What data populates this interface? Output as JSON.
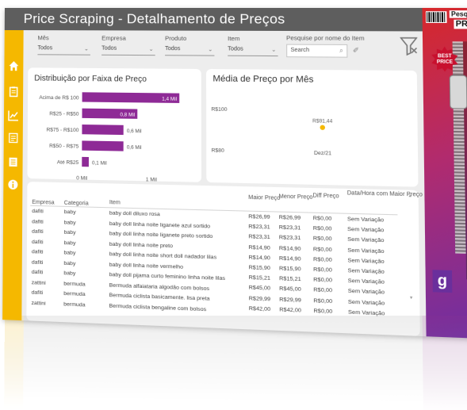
{
  "header": {
    "title": "Price Scraping - Detalhamento de Preços"
  },
  "filters": [
    {
      "label": "Mês",
      "value": "Todos"
    },
    {
      "label": "Empresa",
      "value": "Todos"
    },
    {
      "label": "Produto",
      "value": "Todos"
    },
    {
      "label": "Item",
      "value": "Todos"
    }
  ],
  "search": {
    "label": "Pesquise por nome do Item",
    "placeholder": "Search"
  },
  "sidebar_icons": [
    "home-icon",
    "clipboard-icon",
    "chart-icon",
    "document-icon",
    "list-icon",
    "info-icon"
  ],
  "banner": {
    "line1": "Pesquisa de",
    "line2": "PREÇOS",
    "badge1": "BEST",
    "badge2": "PRICE",
    "logo": "g"
  },
  "bar_chart": {
    "title": "Distribuição por Faixa de Preço",
    "categories": [
      "Acima de R$ 100",
      "R$25 - R$50",
      "R$75 - R$100",
      "R$50 - R$75",
      "Até R$25"
    ],
    "values_label": [
      "1,4 Mil",
      "0,8 Mil",
      "0,6 Mil",
      "0,6 Mil",
      "0,1 Mil"
    ],
    "axis_ticks": [
      "0 Mil",
      "1 Mil"
    ]
  },
  "line_chart": {
    "title": "Média de Preço por Mês",
    "y_ticks": [
      "R$100",
      "R$80"
    ],
    "point_label": "R$91,44",
    "x_tick": "Dez/21"
  },
  "chart_data": [
    {
      "type": "bar",
      "title": "Distribuição por Faixa de Preço",
      "categories": [
        "Acima de R$ 100",
        "R$25 - R$50",
        "R$75 - R$100",
        "R$50 - R$75",
        "Até R$25"
      ],
      "values": [
        1400,
        800,
        600,
        600,
        100
      ],
      "xlim": [
        0,
        1500
      ],
      "color": "#8e2a96"
    },
    {
      "type": "scatter",
      "title": "Média de Preço por Mês",
      "x": [
        "Dez/21"
      ],
      "y": [
        91.44
      ],
      "ylim": [
        80,
        100
      ],
      "color": "#f5b800"
    }
  ],
  "table": {
    "columns": [
      "Empresa",
      "Categoria",
      "Item",
      "Maior Preço",
      "Menor Preço",
      "Diff Preço",
      "Data/Hora com Maior Preço"
    ],
    "rows": [
      [
        "dafiti",
        "baby",
        "baby doll diluxo rosa",
        "R$26,99",
        "R$26,99",
        "R$0,00",
        "Sem Variação"
      ],
      [
        "dafiti",
        "baby",
        "baby doll linha noite liganete azul sortido",
        "R$23,31",
        "R$23,31",
        "R$0,00",
        "Sem Variação"
      ],
      [
        "dafiti",
        "baby",
        "baby doll linha noite liganete preto sortido",
        "R$23,31",
        "R$23,31",
        "R$0,00",
        "Sem Variação"
      ],
      [
        "dafiti",
        "baby",
        "baby doll linha noite preto",
        "R$14,90",
        "R$14,90",
        "R$0,00",
        "Sem Variação"
      ],
      [
        "dafiti",
        "baby",
        "baby doll linha noite short doll nadador lilas",
        "R$14,90",
        "R$14,90",
        "R$0,00",
        "Sem Variação"
      ],
      [
        "dafiti",
        "baby",
        "baby doll linha noite vermelho",
        "R$15,90",
        "R$15,90",
        "R$0,00",
        "Sem Variação"
      ],
      [
        "dafiti",
        "baby",
        "baby doll pijama curto feminino linha noite lilas",
        "R$15,21",
        "R$15,21",
        "R$0,00",
        "Sem Variação"
      ],
      [
        "zattini",
        "bermuda",
        "Bermuda alfaiataria algodão com bolsos",
        "R$45,00",
        "R$45,00",
        "R$0,00",
        "Sem Variação"
      ],
      [
        "dafiti",
        "bermuda",
        "Bermuda ciclista basicamente. lisa preta",
        "R$29,99",
        "R$29,99",
        "R$0,00",
        "Sem Variação"
      ],
      [
        "zattini",
        "bermuda",
        "Bermuda ciclista bengaline com bolsos",
        "R$42,00",
        "R$42,00",
        "R$0,00",
        "Sem Variação"
      ]
    ]
  }
}
